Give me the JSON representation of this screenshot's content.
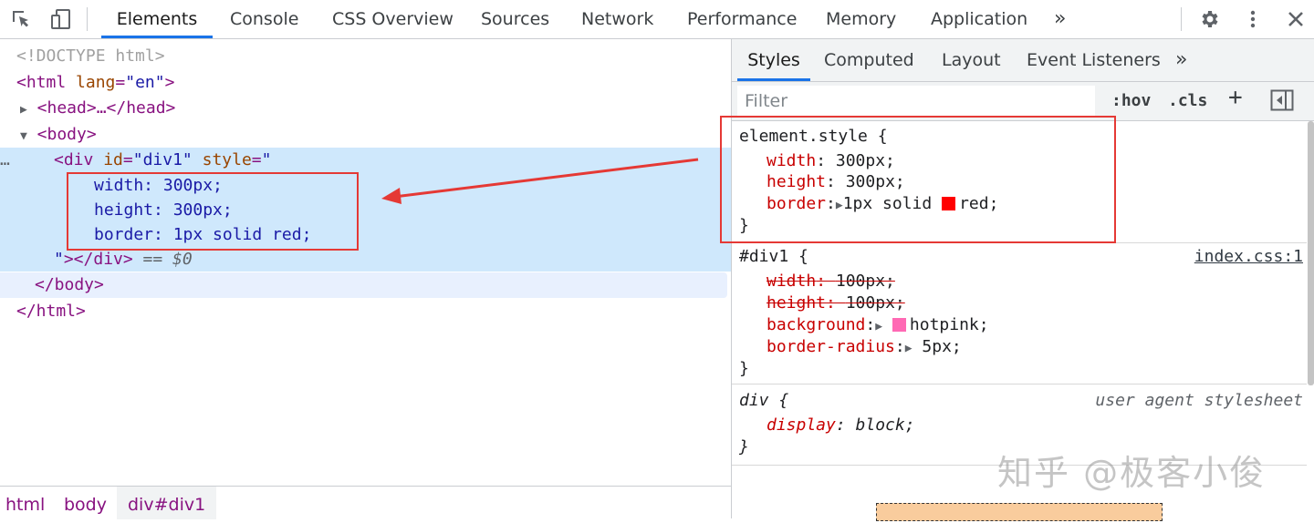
{
  "toolbar": {
    "tabs": [
      "Elements",
      "Console",
      "CSS Overview",
      "Sources",
      "Network",
      "Performance",
      "Memory",
      "Application"
    ],
    "more": "»"
  },
  "dom": {
    "doctype": "<!DOCTYPE html>",
    "html_open": "<html",
    "lang_attr": "lang",
    "lang_val": "\"en\"",
    "head": "<head>…</head>",
    "body_open": "<body>",
    "div_open": "<div",
    "id_attr": "id",
    "id_val": "\"div1\"",
    "style_attr": "style",
    "style_open": "\"",
    "style_lines": [
      "width: 300px;",
      "height: 300px;",
      "border: 1px solid red;"
    ],
    "style_close": "\"",
    "div_close": "></div>",
    "selected_marker": "== $0",
    "body_close": "</body>",
    "html_close": "</html>",
    "ellipsis": "…"
  },
  "breadcrumbs": [
    "html",
    "body",
    "div#div1"
  ],
  "right_panel": {
    "tabs": [
      "Styles",
      "Computed",
      "Layout",
      "Event Listeners"
    ],
    "more": "»",
    "filter_placeholder": "Filter",
    "hov": ":hov",
    "cls": ".cls",
    "plus": "+"
  },
  "rules": {
    "element_style": {
      "selector": "element.style {",
      "props": [
        {
          "name": "width",
          "value": "300px;"
        },
        {
          "name": "height",
          "value": "300px;"
        },
        {
          "name": "border",
          "value": "1px solid",
          "swatch": "#ff0000",
          "after": "red;"
        }
      ],
      "close": "}"
    },
    "div1": {
      "selector": "#div1 {",
      "source": "index.css:1",
      "props": [
        {
          "name": "width",
          "value": "100px;"
        },
        {
          "name": "height",
          "value": "100px;"
        },
        {
          "name": "background",
          "swatch": "#ff69b4",
          "value": "hotpink;"
        },
        {
          "name": "border-radius",
          "value": "5px;"
        }
      ],
      "close": "}"
    },
    "ua": {
      "selector": "div {",
      "source": "user agent stylesheet",
      "props": [
        {
          "name": "display",
          "value": "block;"
        }
      ],
      "close": "}"
    }
  },
  "watermark": "知乎 @极客小俊",
  "colors": {
    "accent": "#1a73e8",
    "highlight": "#e53935",
    "swatch_red": "#ff0000",
    "swatch_hotpink": "#ff69b4"
  }
}
